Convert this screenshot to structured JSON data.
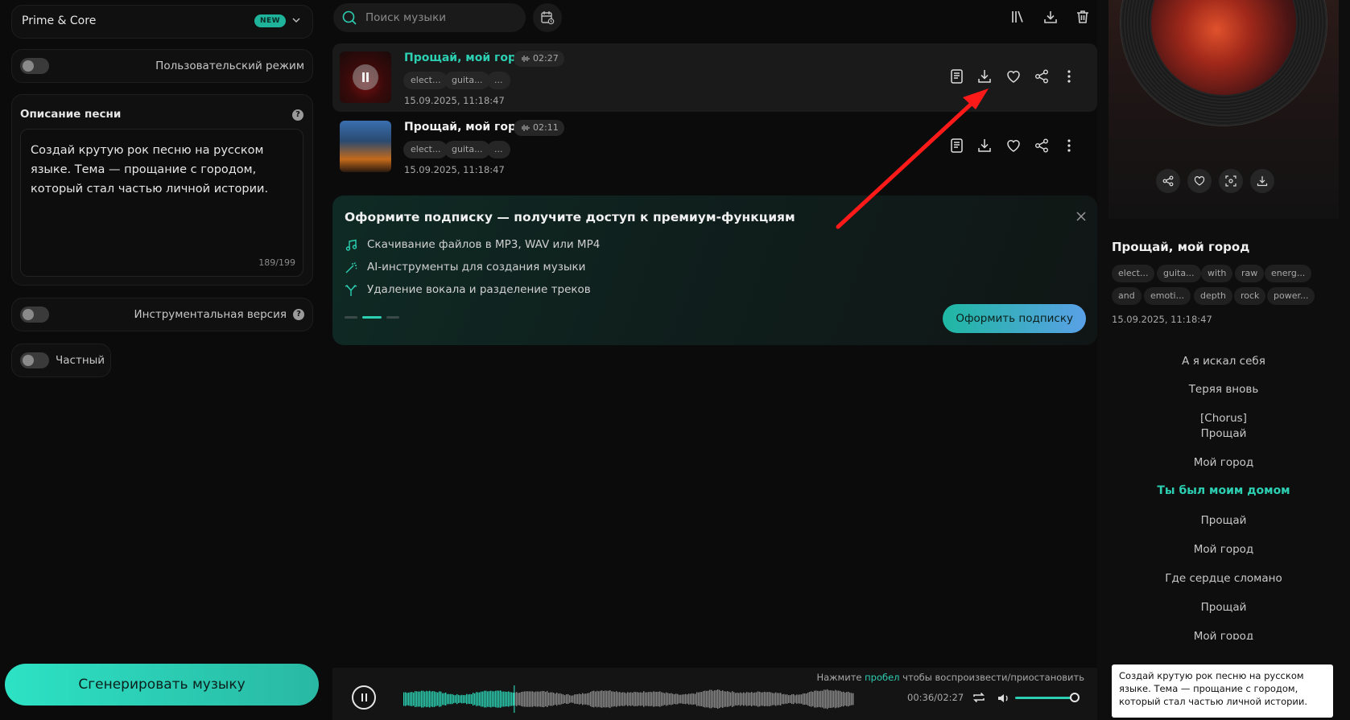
{
  "left": {
    "model_name": "Prime & Core",
    "model_badge": "NEW",
    "custom_mode_label": "Пользовательский режим",
    "description_title": "Описание песни",
    "description_text": "Создай крутую рок песню на русском языке. Тема — прощание с городом, который стал частью личной истории.",
    "char_count": "189/199",
    "instrumental_label": "Инструментальная версия",
    "private_label": "Частный",
    "generate_button": "Сгенерировать музыку"
  },
  "center": {
    "search_placeholder": "Поиск музыки",
    "tracks": [
      {
        "title": "Прощай, мой город",
        "duration": "02:27",
        "tags": [
          "elect...",
          "guita...",
          "..."
        ],
        "date": "15.09.2025, 11:18:47",
        "active": true
      },
      {
        "title": "Прощай, мой город",
        "duration": "02:11",
        "tags": [
          "elect...",
          "guita...",
          "..."
        ],
        "date": "15.09.2025, 11:18:47",
        "active": false
      }
    ],
    "promo": {
      "title": "Оформите подписку — получите доступ к премиум-функциям",
      "features": [
        "Скачивание файлов в MP3, WAV или MP4",
        "AI-инструменты для создания музыки",
        "Удаление вокала и разделение треков"
      ],
      "button": "Оформить подписку"
    }
  },
  "player": {
    "hint_prefix": "Нажмите",
    "hint_key": "пробел",
    "hint_suffix": "чтобы воспроизвести/приостановить",
    "time": "00:36/02:27",
    "progress": 0.245,
    "volume": 0.88
  },
  "right": {
    "title": "Прощай, мой город",
    "tags_row1": [
      "elect...",
      "guita...",
      "with",
      "raw",
      "energ..."
    ],
    "tags_row2": [
      "and",
      "emoti...",
      "depth",
      "rock",
      "power..."
    ],
    "date": "15.09.2025, 11:18:47",
    "lyrics": [
      {
        "text": "А я искал себя",
        "highlight": false
      },
      {
        "text": "Теряя вновь",
        "highlight": false
      },
      {
        "text": "[Chorus]",
        "highlight": false
      },
      {
        "text": "Прощай",
        "highlight": false
      },
      {
        "text": "Мой город",
        "highlight": false
      },
      {
        "text": "Ты был моим домом",
        "highlight": true
      },
      {
        "text": "Прощай",
        "highlight": false
      },
      {
        "text": "Мой город",
        "highlight": false
      },
      {
        "text": "Где сердце сломано",
        "highlight": false
      },
      {
        "text": "Прощай",
        "highlight": false
      },
      {
        "text": "Мой город",
        "highlight": false
      }
    ],
    "tooltip": "Создай крутую рок песню на русском языке. Тема — прощание с городом, который стал частью личной истории."
  },
  "colors": {
    "accent": "#2ccfb2",
    "annotation_arrow": "#ff1a1a"
  },
  "icons": [
    "search-icon",
    "calendar-icon",
    "library-icon",
    "download-icon",
    "trash-icon",
    "lyrics-icon",
    "heart-icon",
    "share-icon",
    "more-icon",
    "close-icon",
    "music-note-icon",
    "magic-wand-icon",
    "split-icon",
    "repeat-icon",
    "volume-icon",
    "fullscreen-icon",
    "chevron-down-icon",
    "help-icon"
  ]
}
